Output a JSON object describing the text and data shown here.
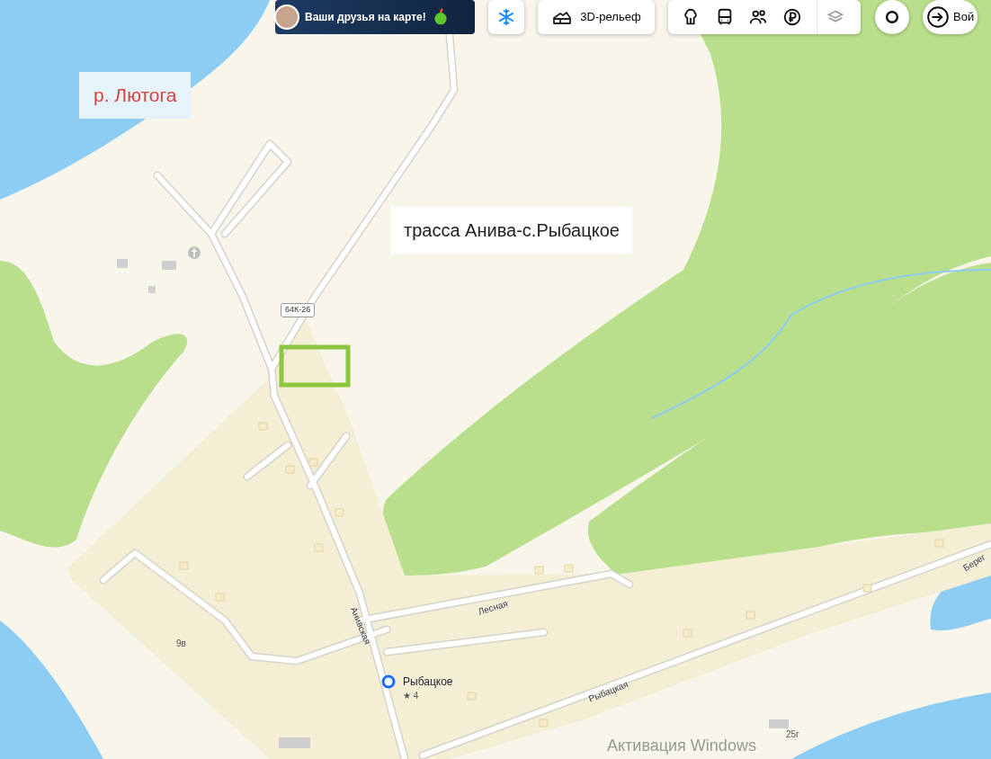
{
  "toolbar": {
    "promo": {
      "text": "Ваши друзья на карте!"
    },
    "relief_button": {
      "label": "3D-рельеф"
    },
    "login_button": {
      "label": "Вой"
    }
  },
  "map": {
    "annotations": [
      {
        "kind": "river",
        "text": "р. Лютога"
      },
      {
        "kind": "road",
        "text": "трасса Анива-с.Рыбацкое"
      }
    ],
    "road_shield": "64К-26",
    "streets": [
      "Лесная",
      "Анивская",
      "Рыбацкая",
      "Берег"
    ],
    "place": {
      "name": "Рыбацкое",
      "rating": "★ 4"
    },
    "house_numbers": [
      "9в",
      "25г"
    ]
  },
  "os_overlay": "Активация Windows"
}
